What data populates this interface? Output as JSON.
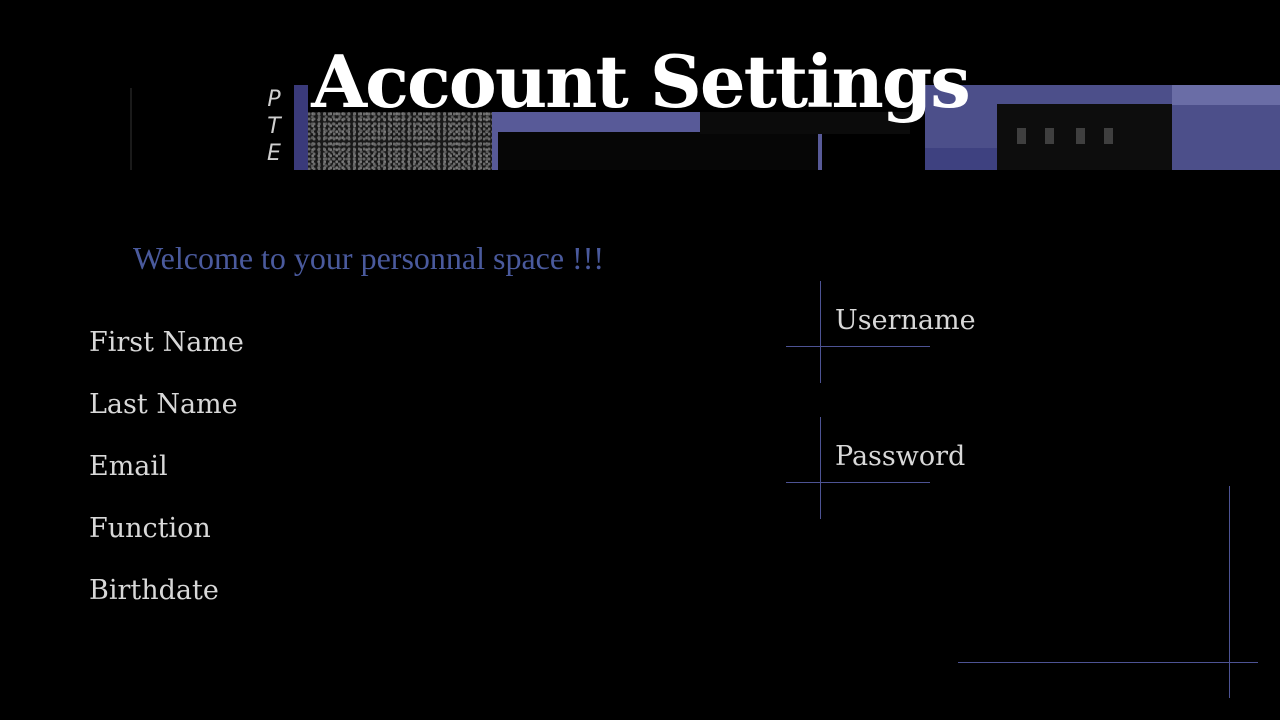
{
  "header": {
    "title": "Account Settings",
    "banner_letters": [
      "P",
      "T",
      "E"
    ]
  },
  "welcome": {
    "text": "Welcome to your personnal space !!!"
  },
  "profile": {
    "fields": [
      {
        "label": "First Name"
      },
      {
        "label": "Last Name"
      },
      {
        "label": "Email"
      },
      {
        "label": "Function"
      },
      {
        "label": "Birthdate"
      }
    ]
  },
  "credentials": {
    "username_label": "Username",
    "password_label": "Password"
  },
  "colors": {
    "background": "#000000",
    "title": "#ffffff",
    "welcome": "#4a5a9d",
    "labels": "#d8d8d8",
    "accent_lines": "#4d5394"
  }
}
